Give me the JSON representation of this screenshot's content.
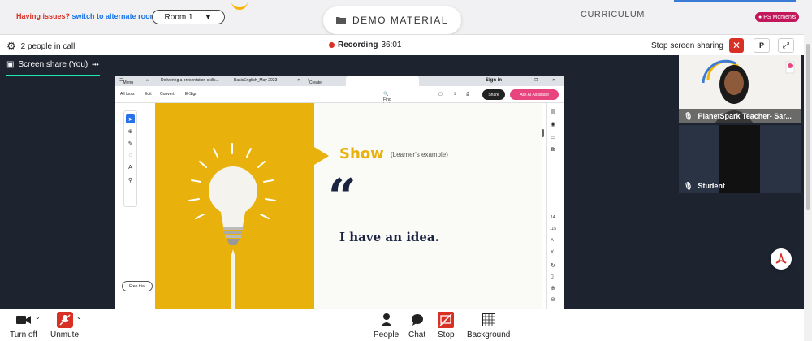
{
  "header": {
    "issues_text": "Having issues?",
    "alternate_room_link": "switch to alternate room",
    "room_select": "Room 1",
    "demo_title": "DEMO MATERIAL",
    "curriculum": "CURRICULUM",
    "ps_moments": "PS Moments"
  },
  "callbar": {
    "people_count": "2 people in call",
    "recording_label": "Recording",
    "recording_time": "36:01",
    "stop_sharing": "Stop screen sharing",
    "p_button": "P"
  },
  "share": {
    "tab_label": "Screen share (You)",
    "more": "•••"
  },
  "browser": {
    "menu": "Menu",
    "tab1": "Delivering a presentation skills...",
    "tab2": "BasicEnglish_May 2023",
    "create": "Create",
    "signin": "Sign in",
    "all_tools": "All tools",
    "edit": "Edit",
    "convert": "Convert",
    "esign": "E-Sign",
    "find": "Find text or tools",
    "share": "Share",
    "ai_assistant": "Ask AI Assistant",
    "free_trial": "Free trial",
    "page_num": "14",
    "page_total": "115"
  },
  "slide": {
    "show_word": "Show",
    "learner_example": "(Learner's example)",
    "quote": "“",
    "idea": "I have an idea."
  },
  "tiles": {
    "teacher": "PlanetSpark Teacher- Sar...",
    "student": "Student"
  },
  "bottombar": {
    "turn_off": "Turn off",
    "unmute": "Unmute",
    "people": "People",
    "chat": "Chat",
    "stop": "Stop",
    "background": "Background"
  },
  "colors": {
    "accent_red": "#d93025",
    "slide_yellow": "#e8b10c",
    "navy": "#1a2440",
    "dark_bg": "#1d2430"
  }
}
